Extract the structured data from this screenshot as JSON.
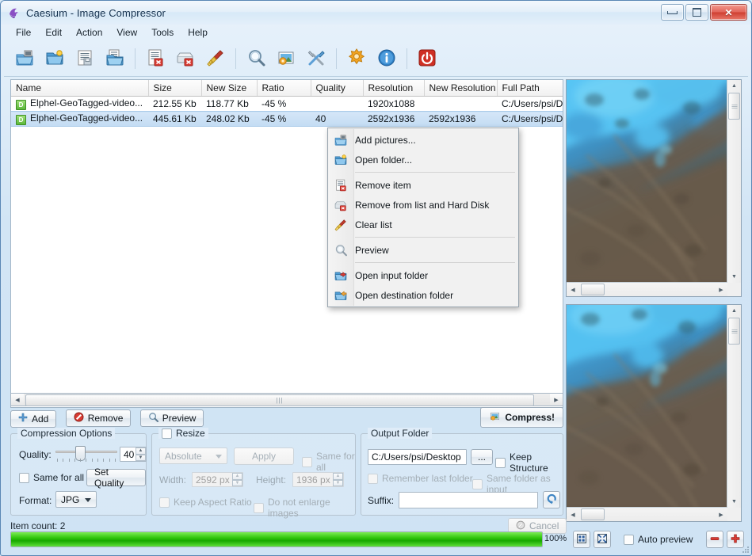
{
  "window": {
    "title": "Caesium - Image Compressor",
    "icon": "caesium-bird-icon",
    "controls": {
      "minimize": "minimize-button",
      "maximize": "maximize-button",
      "close": "close-button"
    }
  },
  "menubar": {
    "items": [
      {
        "label": "File"
      },
      {
        "label": "Edit"
      },
      {
        "label": "Action"
      },
      {
        "label": "View"
      },
      {
        "label": "Tools"
      },
      {
        "label": "Help"
      }
    ]
  },
  "toolbar": {
    "buttons": [
      {
        "name": "add-pictures-icon",
        "tip": "Add pictures"
      },
      {
        "name": "open-folder-icon",
        "tip": "Open folder"
      },
      {
        "name": "save-list-icon",
        "tip": "Save list"
      },
      {
        "name": "open-list-icon",
        "tip": "Open list"
      },
      {
        "name": "remove-item-icon",
        "tip": "Remove item"
      },
      {
        "name": "remove-from-disk-icon",
        "tip": "Remove from list and Hard Disk"
      },
      {
        "name": "clear-list-icon",
        "tip": "Clear list"
      },
      {
        "name": "preview-icon",
        "tip": "Preview"
      },
      {
        "name": "compress-icon",
        "tip": "Compress"
      },
      {
        "name": "tools-icon",
        "tip": "Tools"
      },
      {
        "name": "options-icon",
        "tip": "Options"
      },
      {
        "name": "info-icon",
        "tip": "Info"
      },
      {
        "name": "exit-icon",
        "tip": "Exit"
      }
    ]
  },
  "file_list": {
    "columns": [
      "Name",
      "Size",
      "New Size",
      "Ratio",
      "Quality",
      "Resolution",
      "New Resolution",
      "Full Path"
    ],
    "rows": [
      {
        "icon": "D",
        "name": "Elphel-GeoTagged-video...",
        "size": "212.55 Kb",
        "new_size": "118.77 Kb",
        "ratio": "-45 %",
        "quality": "",
        "resolution": "1920x1088",
        "new_resolution": "",
        "full_path": "C:/Users/psi/De",
        "selected": false
      },
      {
        "icon": "D",
        "name": "Elphel-GeoTagged-video...",
        "size": "445.61 Kb",
        "new_size": "248.02 Kb",
        "ratio": "-45 %",
        "quality": "40",
        "resolution": "2592x1936",
        "new_resolution": "2592x1936",
        "full_path": "C:/Users/psi/De",
        "selected": true
      }
    ]
  },
  "context_menu": {
    "items": [
      {
        "label": "Add pictures...",
        "icon": "add-pictures-icon",
        "separator_after": false
      },
      {
        "label": "Open folder...",
        "icon": "open-folder-icon",
        "separator_after": true
      },
      {
        "label": "Remove item",
        "icon": "remove-item-icon",
        "separator_after": false
      },
      {
        "label": "Remove from list and Hard Disk",
        "icon": "remove-from-disk-icon",
        "separator_after": false
      },
      {
        "label": "Clear list",
        "icon": "clear-list-icon",
        "separator_after": true
      },
      {
        "label": "Preview",
        "icon": "preview-magnifier-icon",
        "separator_after": true
      },
      {
        "label": "Open input folder",
        "icon": "open-input-folder-icon",
        "separator_after": false
      },
      {
        "label": "Open destination folder",
        "icon": "open-destination-folder-icon",
        "separator_after": false
      }
    ]
  },
  "actions": {
    "add": "Add",
    "remove": "Remove",
    "preview": "Preview",
    "compress": "Compress!"
  },
  "compression_options": {
    "legend": "Compression Options",
    "quality_label": "Quality:",
    "quality_value": "40",
    "same_for_all_label": "Same for all",
    "set_quality_label": "Set Quality",
    "format_label": "Format:",
    "format_value": "JPG"
  },
  "resize": {
    "legend": "Resize",
    "mode_value": "Absolute",
    "apply_label": "Apply",
    "same_for_all_label": "Same for all",
    "width_label": "Width:",
    "width_value": "2592 px",
    "height_label": "Height:",
    "height_value": "1936 px",
    "keep_aspect_label": "Keep Aspect Ratio",
    "do_not_enlarge_label": "Do not enlarge images"
  },
  "output_folder": {
    "legend": "Output Folder",
    "path_value": "C:/Users/psi/Desktop",
    "browse_label": "...",
    "keep_structure_label": "Keep Structure",
    "remember_last_label": "Remember last folder",
    "same_folder_label": "Same folder as input",
    "suffix_label": "Suffix:",
    "suffix_value": "",
    "suffix_placeholder": "",
    "reset_icon": "reset-arrow-icon"
  },
  "status": {
    "item_count": "Item count: 2",
    "cancel_label": "Cancel",
    "progress_percent": "100%",
    "progress_value": 100
  },
  "preview": {
    "fit_icon": "fit-to-window-icon",
    "expand_icon": "expand-icon",
    "auto_preview_label": "Auto preview",
    "zoom_out_icon": "zoom-out-icon",
    "zoom_in_icon": "zoom-in-icon",
    "pane_top": "original-preview-pane",
    "pane_bottom": "compressed-preview-pane"
  },
  "colors": {
    "accent": "#3a6ea5",
    "progress_green": "#18a800",
    "selection": "#c3dcf3",
    "close_red": "#cf3f31"
  }
}
